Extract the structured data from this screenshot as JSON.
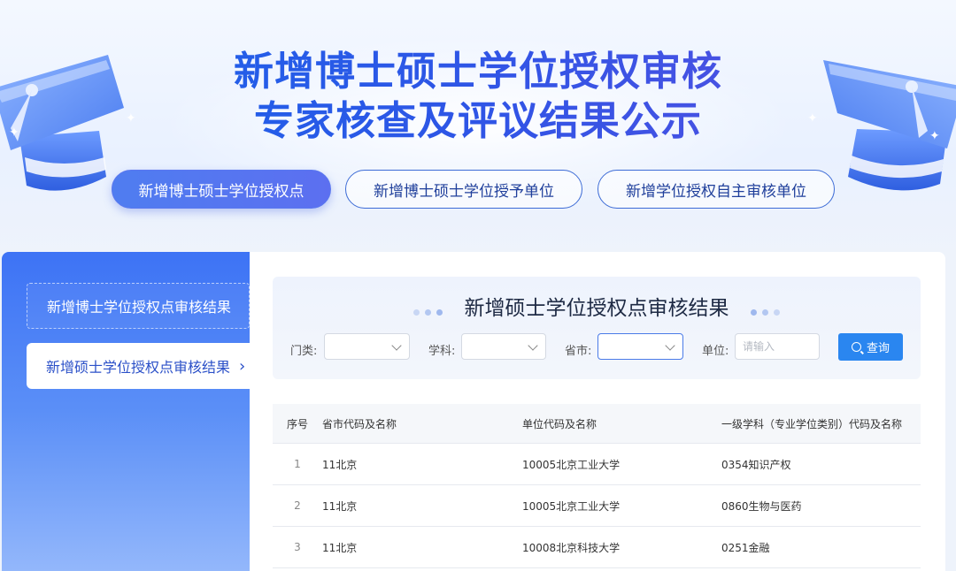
{
  "hero": {
    "title_line1": "新增博士硕士学位授权审核",
    "title_line2": "专家核查及评议结果公示"
  },
  "tabs": [
    {
      "label": "新增博士硕士学位授权点",
      "active": true
    },
    {
      "label": "新增博士硕士学位授予单位",
      "active": false
    },
    {
      "label": "新增学位授权自主审核单位",
      "active": false
    }
  ],
  "sidebar": {
    "items": [
      {
        "label": "新增博士学位授权点审核结果",
        "active": false
      },
      {
        "label": "新增硕士学位授权点审核结果",
        "active": true
      }
    ],
    "active_chevron": "›"
  },
  "panel": {
    "title": "新增硕士学位授权点审核结果",
    "filters": {
      "category_label": "门类:",
      "discipline_label": "学科:",
      "province_label": "省市:",
      "unit_label": "单位:",
      "unit_placeholder": "请输入"
    },
    "query_button": "查询"
  },
  "table": {
    "headers": [
      "序号",
      "省市代码及名称",
      "单位代码及名称",
      "一级学科（专业学位类别）代码及名称"
    ],
    "rows": [
      {
        "no": "1",
        "province": "11北京",
        "unit": "10005北京工业大学",
        "discipline": "0354知识产权"
      },
      {
        "no": "2",
        "province": "11北京",
        "unit": "10005北京工业大学",
        "discipline": "0860生物与医药"
      },
      {
        "no": "3",
        "province": "11北京",
        "unit": "10008北京科技大学",
        "discipline": "0251金融"
      }
    ]
  },
  "colors": {
    "accent": "#2a86f0",
    "title_gradient_start": "#1865ea",
    "title_gradient_end": "#5b4fe0",
    "sidebar_top": "#3d73f5",
    "tab_active": "#4f7df0"
  },
  "icons": {
    "left_decoration": "graduation-cap-icon",
    "right_decoration": "graduation-cap-icon",
    "query": "search-icon",
    "select_arrow": "chevron-down-icon"
  }
}
